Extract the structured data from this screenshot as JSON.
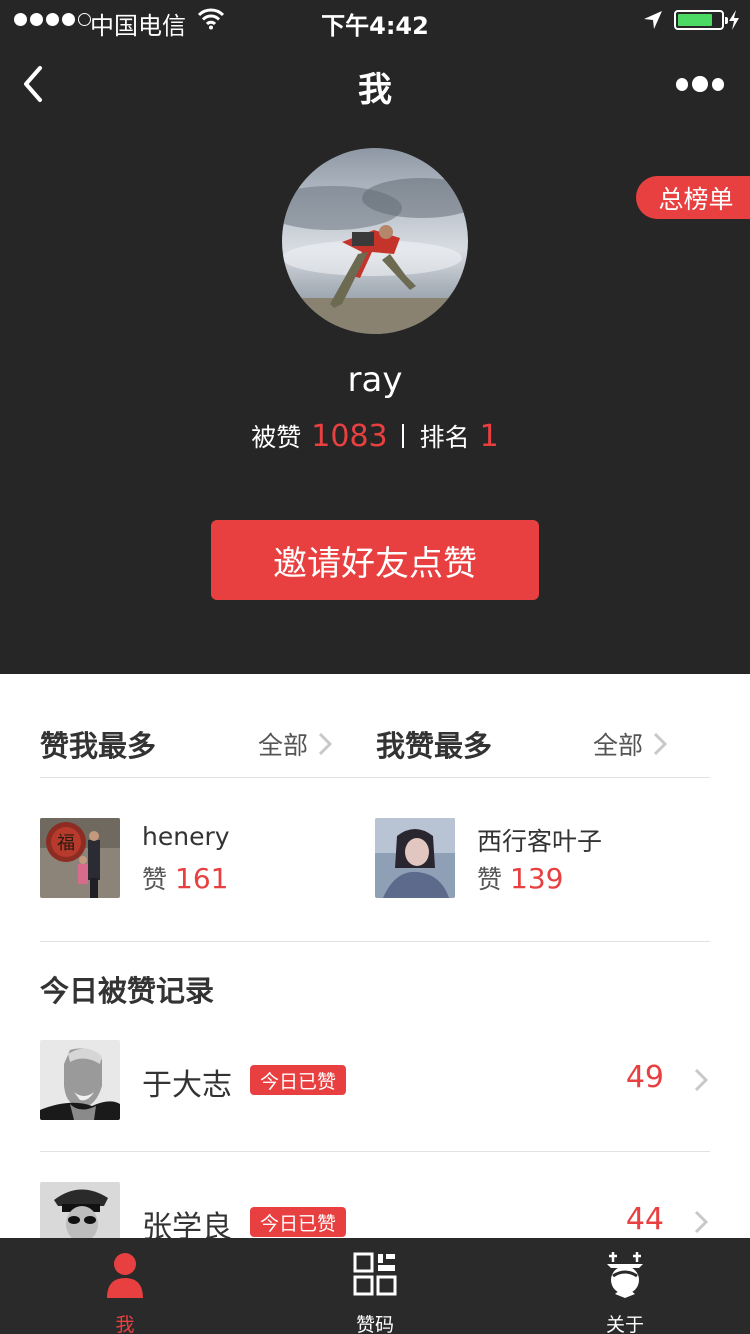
{
  "status_bar": {
    "carrier": "中国电信",
    "time": "下午4:42"
  },
  "nav": {
    "title": "我"
  },
  "rank_tag": "总榜单",
  "profile": {
    "username": "ray",
    "likes_label": "被赞",
    "likes_count": "1083",
    "rank_label": "排名",
    "rank_value": "1"
  },
  "invite_button": "邀请好友点赞",
  "most_liked_me": {
    "title": "赞我最多",
    "all_label": "全部",
    "user": {
      "name": "henery",
      "likes_label": "赞",
      "likes": "161"
    }
  },
  "i_liked_most": {
    "title": "我赞最多",
    "all_label": "全部",
    "user": {
      "name": "西行客叶子",
      "likes_label": "赞",
      "likes": "139"
    }
  },
  "today": {
    "title": "今日被赞记录",
    "records": [
      {
        "name": "于大志",
        "badge": "今日已赞",
        "count": "49"
      },
      {
        "name": "张学良",
        "badge": "今日已赞",
        "count": "44"
      }
    ]
  },
  "tabbar": {
    "tabs": [
      {
        "label": "我",
        "icon": "person-icon",
        "active": true
      },
      {
        "label": "赞码",
        "icon": "qr-code-icon",
        "active": false
      },
      {
        "label": "关于",
        "icon": "about-icon",
        "active": false
      }
    ]
  },
  "colors": {
    "accent": "#e84040",
    "header_bg": "#262626",
    "tabbar_bg": "#2a2a2a"
  }
}
